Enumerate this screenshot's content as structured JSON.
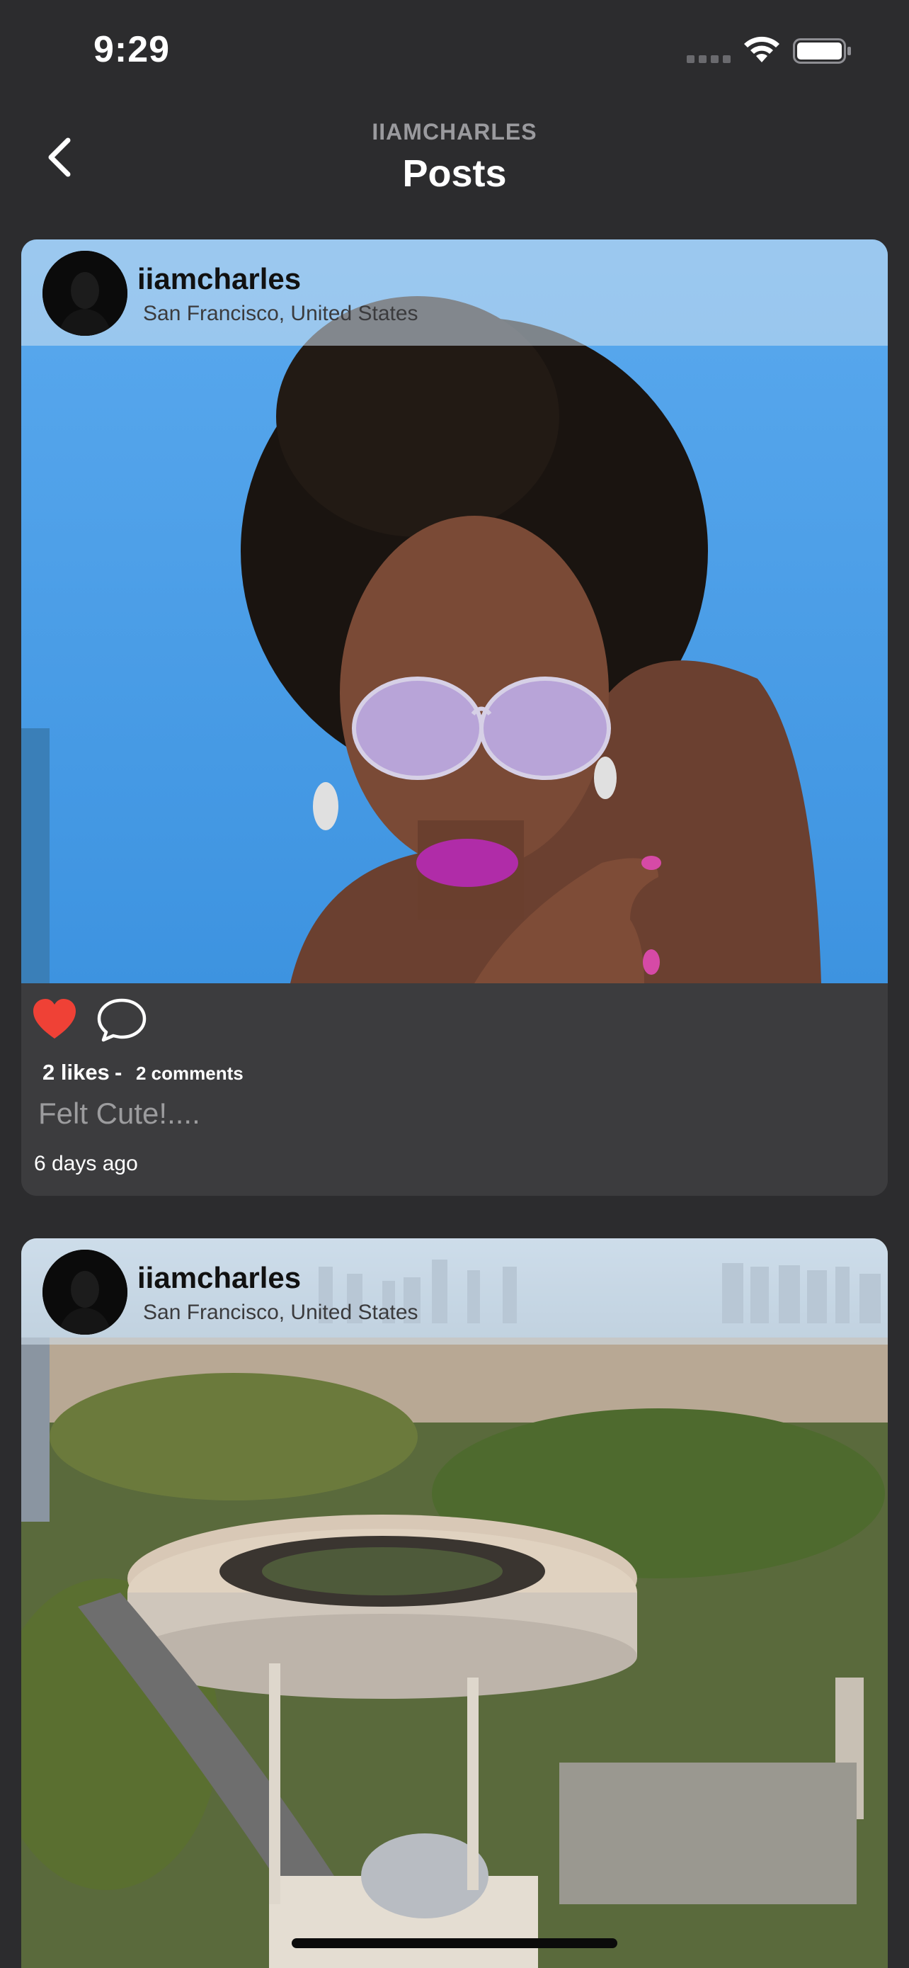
{
  "status_bar": {
    "time": "9:29"
  },
  "header": {
    "subtitle": "IIAMCHARLES",
    "title": "Posts"
  },
  "posts": [
    {
      "username": "iiamcharles",
      "location": "San Francisco, United States",
      "likes": "2 likes",
      "separator": "-",
      "comments": "2 comments",
      "caption": "Felt Cute!....",
      "time_ago": "6 days ago",
      "liked": true
    },
    {
      "username": "iiamcharles",
      "location": "San Francisco, United States"
    }
  ],
  "colors": {
    "background": "#2c2c2e",
    "card": "#3c3c3e",
    "like": "#ef4136",
    "sky": "#4a9fe8"
  }
}
